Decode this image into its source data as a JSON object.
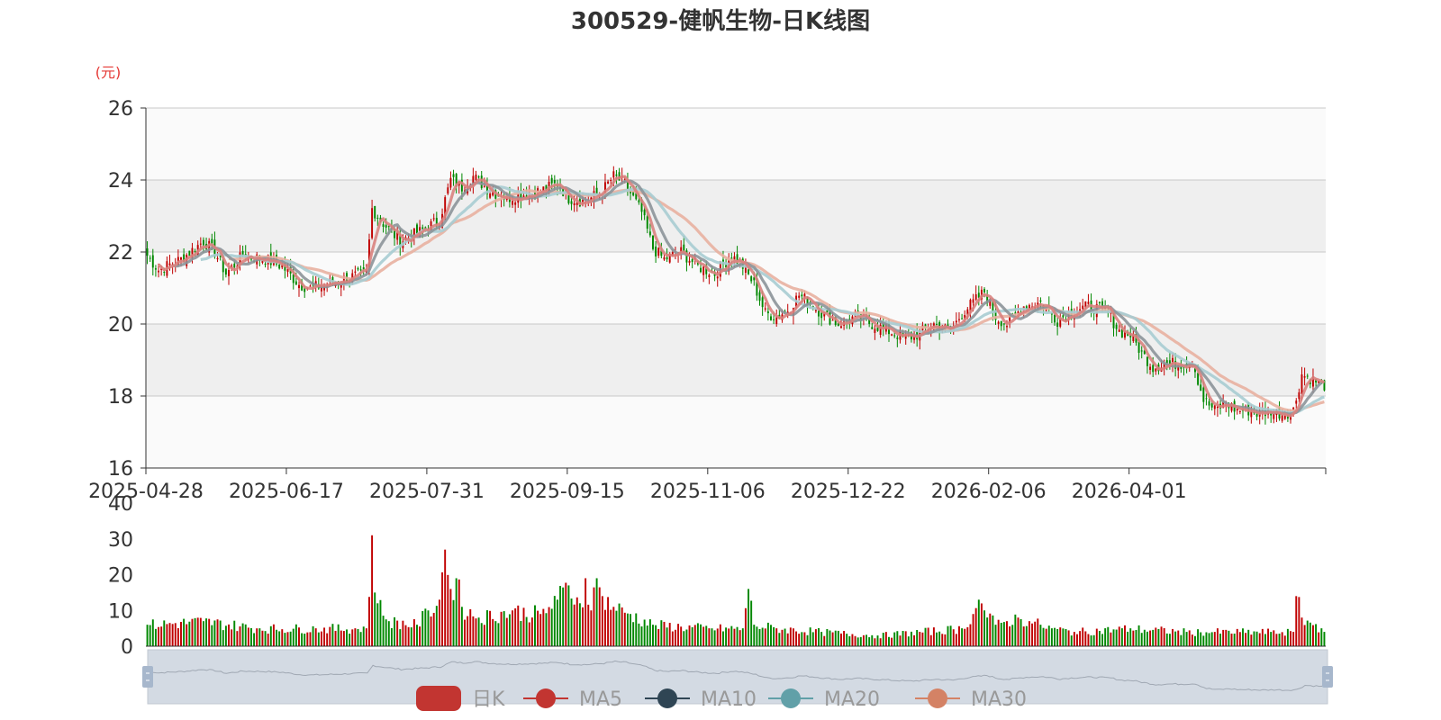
{
  "chart_data": {
    "type": "candlestick",
    "title": "300529-健帆生物-日K线图",
    "unit_label": "(元)",
    "price_axis": {
      "ylim": [
        16,
        26
      ],
      "ticks": [
        "26",
        "24",
        "22",
        "20",
        "18",
        "16"
      ]
    },
    "volume_axis": {
      "ylim": [
        0,
        40
      ],
      "ticks": [
        "40",
        "30",
        "20",
        "10",
        "0"
      ]
    },
    "x_tick_labels": [
      "2025-04-28",
      "2025-06-17",
      "2025-07-31",
      "2025-09-15",
      "2025-11-06",
      "2025-12-22",
      "2026-02-06",
      "2026-04-01"
    ],
    "grid": true,
    "legend": {
      "position": "bottom",
      "items": [
        {
          "name": "日K",
          "color": "#c23531",
          "icon": "rounded-rect"
        },
        {
          "name": "MA5",
          "color": "#c23531",
          "icon": "circle-line"
        },
        {
          "name": "MA10",
          "color": "#2f4554",
          "icon": "circle-line"
        },
        {
          "name": "MA20",
          "color": "#61a0a8",
          "icon": "circle-line"
        },
        {
          "name": "MA30",
          "color": "#d48265",
          "icon": "circle-line"
        }
      ]
    },
    "colors": {
      "up": "#c00000",
      "down": "#008800",
      "ma5": "#d9827e",
      "ma10": "#8c9399",
      "ma20": "#a7ccd1",
      "ma30": "#e8b0a0",
      "zoom_fill": "#d3dae3",
      "zoom_handle": "#a7b7cc"
    },
    "close_anchors": [
      [
        0,
        21.9
      ],
      [
        4,
        21.5
      ],
      [
        12,
        21.8
      ],
      [
        20,
        22.3
      ],
      [
        24,
        22.0
      ],
      [
        28,
        21.4
      ],
      [
        34,
        21.9
      ],
      [
        42,
        21.8
      ],
      [
        48,
        21.6
      ],
      [
        54,
        21.1
      ],
      [
        58,
        21.0
      ],
      [
        64,
        21.1
      ],
      [
        72,
        21.3
      ],
      [
        78,
        21.4
      ],
      [
        80,
        23.2
      ],
      [
        84,
        22.8
      ],
      [
        90,
        22.3
      ],
      [
        98,
        22.6
      ],
      [
        104,
        22.9
      ],
      [
        108,
        24.0
      ],
      [
        112,
        23.8
      ],
      [
        116,
        24.1
      ],
      [
        122,
        23.7
      ],
      [
        128,
        23.5
      ],
      [
        134,
        23.6
      ],
      [
        140,
        23.7
      ],
      [
        146,
        23.9
      ],
      [
        150,
        23.5
      ],
      [
        156,
        23.4
      ],
      [
        162,
        23.7
      ],
      [
        166,
        24.1
      ],
      [
        170,
        23.9
      ],
      [
        176,
        23.1
      ],
      [
        180,
        22.1
      ],
      [
        184,
        21.8
      ],
      [
        190,
        22.0
      ],
      [
        196,
        21.6
      ],
      [
        202,
        21.4
      ],
      [
        208,
        21.9
      ],
      [
        212,
        21.6
      ],
      [
        216,
        21.1
      ],
      [
        220,
        20.3
      ],
      [
        224,
        20.2
      ],
      [
        228,
        20.4
      ],
      [
        232,
        20.8
      ],
      [
        236,
        20.6
      ],
      [
        240,
        20.3
      ],
      [
        246,
        20.0
      ],
      [
        252,
        20.2
      ],
      [
        258,
        20.0
      ],
      [
        264,
        19.8
      ],
      [
        270,
        19.6
      ],
      [
        274,
        19.7
      ],
      [
        280,
        20.0
      ],
      [
        286,
        19.8
      ],
      [
        290,
        20.3
      ],
      [
        294,
        20.6
      ],
      [
        298,
        20.9
      ],
      [
        302,
        20.2
      ],
      [
        306,
        20.0
      ],
      [
        312,
        20.5
      ],
      [
        318,
        20.6
      ],
      [
        324,
        20.1
      ],
      [
        330,
        20.4
      ],
      [
        336,
        20.5
      ],
      [
        342,
        20.3
      ],
      [
        346,
        19.8
      ],
      [
        350,
        19.7
      ],
      [
        354,
        19.2
      ],
      [
        358,
        18.8
      ],
      [
        362,
        18.9
      ],
      [
        368,
        18.9
      ],
      [
        372,
        19.0
      ],
      [
        376,
        17.9
      ],
      [
        380,
        17.6
      ],
      [
        384,
        17.8
      ],
      [
        388,
        17.6
      ],
      [
        392,
        17.6
      ],
      [
        396,
        17.5
      ],
      [
        400,
        17.6
      ],
      [
        404,
        17.5
      ],
      [
        408,
        17.6
      ],
      [
        411,
        18.6
      ],
      [
        414,
        18.5
      ],
      [
        418,
        18.3
      ]
    ],
    "volume_anchors": [
      [
        0,
        6
      ],
      [
        20,
        7
      ],
      [
        40,
        5
      ],
      [
        60,
        5
      ],
      [
        78,
        5
      ],
      [
        80,
        31
      ],
      [
        81,
        15
      ],
      [
        82,
        12
      ],
      [
        86,
        7
      ],
      [
        96,
        6
      ],
      [
        100,
        10
      ],
      [
        104,
        13
      ],
      [
        106,
        27
      ],
      [
        108,
        16
      ],
      [
        110,
        19
      ],
      [
        112,
        11
      ],
      [
        118,
        8
      ],
      [
        130,
        10
      ],
      [
        140,
        9
      ],
      [
        146,
        13
      ],
      [
        150,
        17
      ],
      [
        154,
        12
      ],
      [
        156,
        19
      ],
      [
        158,
        10
      ],
      [
        160,
        19
      ],
      [
        162,
        14
      ],
      [
        166,
        11
      ],
      [
        172,
        9
      ],
      [
        180,
        6
      ],
      [
        200,
        5
      ],
      [
        212,
        5
      ],
      [
        214,
        16
      ],
      [
        216,
        6
      ],
      [
        224,
        5
      ],
      [
        240,
        4
      ],
      [
        260,
        3
      ],
      [
        290,
        5
      ],
      [
        294,
        9
      ],
      [
        296,
        13
      ],
      [
        298,
        10
      ],
      [
        302,
        6
      ],
      [
        306,
        7
      ],
      [
        310,
        8
      ],
      [
        314,
        7
      ],
      [
        318,
        6
      ],
      [
        322,
        5
      ],
      [
        330,
        4
      ],
      [
        350,
        5
      ],
      [
        370,
        4
      ],
      [
        380,
        4
      ],
      [
        400,
        4
      ],
      [
        408,
        4
      ],
      [
        409,
        14
      ],
      [
        411,
        8
      ],
      [
        418,
        5
      ]
    ]
  }
}
